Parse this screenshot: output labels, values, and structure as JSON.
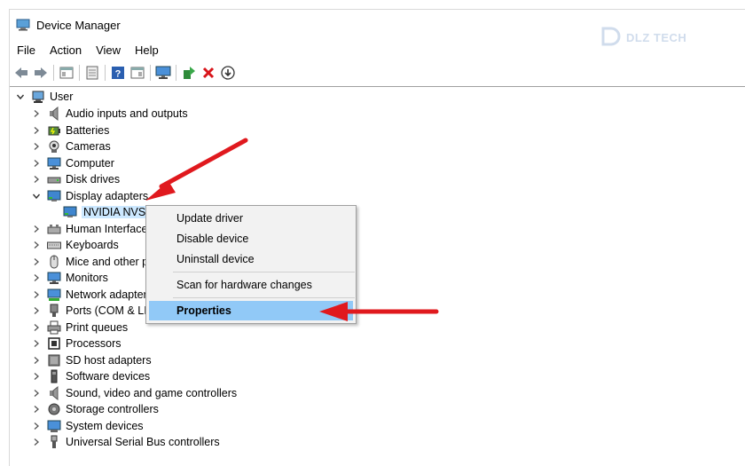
{
  "window": {
    "title": "Device Manager"
  },
  "watermark": {
    "text": "DLZ TECH"
  },
  "menu": [
    "File",
    "Action",
    "View",
    "Help"
  ],
  "toolbar": {
    "buttons": [
      "back-arrow-icon",
      "forward-arrow-icon",
      "properties-icon",
      "update-icon",
      "help-icon",
      "view-icon",
      "monitor-icon",
      "add-driver-icon",
      "uninstall-x-icon",
      "download-icon"
    ]
  },
  "tree": {
    "root": "User",
    "items": [
      {
        "label": "Audio inputs and outputs",
        "icon": "speaker-icon"
      },
      {
        "label": "Batteries",
        "icon": "battery-icon"
      },
      {
        "label": "Cameras",
        "icon": "camera-icon"
      },
      {
        "label": "Computer",
        "icon": "computer-icon"
      },
      {
        "label": "Disk drives",
        "icon": "disk-icon"
      },
      {
        "label": "Display adapters",
        "icon": "display-adapter-icon",
        "expanded": true
      },
      {
        "label": "NVIDIA NVS",
        "icon": "display-adapter-icon",
        "child": true
      },
      {
        "label": "Human Interface",
        "icon": "hid-icon"
      },
      {
        "label": "Keyboards",
        "icon": "keyboard-icon"
      },
      {
        "label": "Mice and other p",
        "icon": "mouse-icon"
      },
      {
        "label": "Monitors",
        "icon": "monitor-icon"
      },
      {
        "label": "Network adapter",
        "icon": "network-icon"
      },
      {
        "label": "Ports (COM & LI",
        "icon": "port-icon"
      },
      {
        "label": "Print queues",
        "icon": "printer-icon"
      },
      {
        "label": "Processors",
        "icon": "processor-icon"
      },
      {
        "label": "SD host adapters",
        "icon": "sd-icon"
      },
      {
        "label": "Software devices",
        "icon": "software-icon"
      },
      {
        "label": "Sound, video and game controllers",
        "icon": "sound-icon"
      },
      {
        "label": "Storage controllers",
        "icon": "storage-icon"
      },
      {
        "label": "System devices",
        "icon": "system-icon"
      },
      {
        "label": "Universal Serial Bus controllers",
        "icon": "usb-icon"
      }
    ]
  },
  "context_menu": {
    "items": [
      "Update driver",
      "Disable device",
      "Uninstall device",
      "Scan for hardware changes",
      "Properties"
    ],
    "active": "Properties"
  },
  "colors": {
    "selection": "#cce8ff",
    "menu_highlight": "#91c9f7",
    "arrow_red": "#e0191e"
  }
}
